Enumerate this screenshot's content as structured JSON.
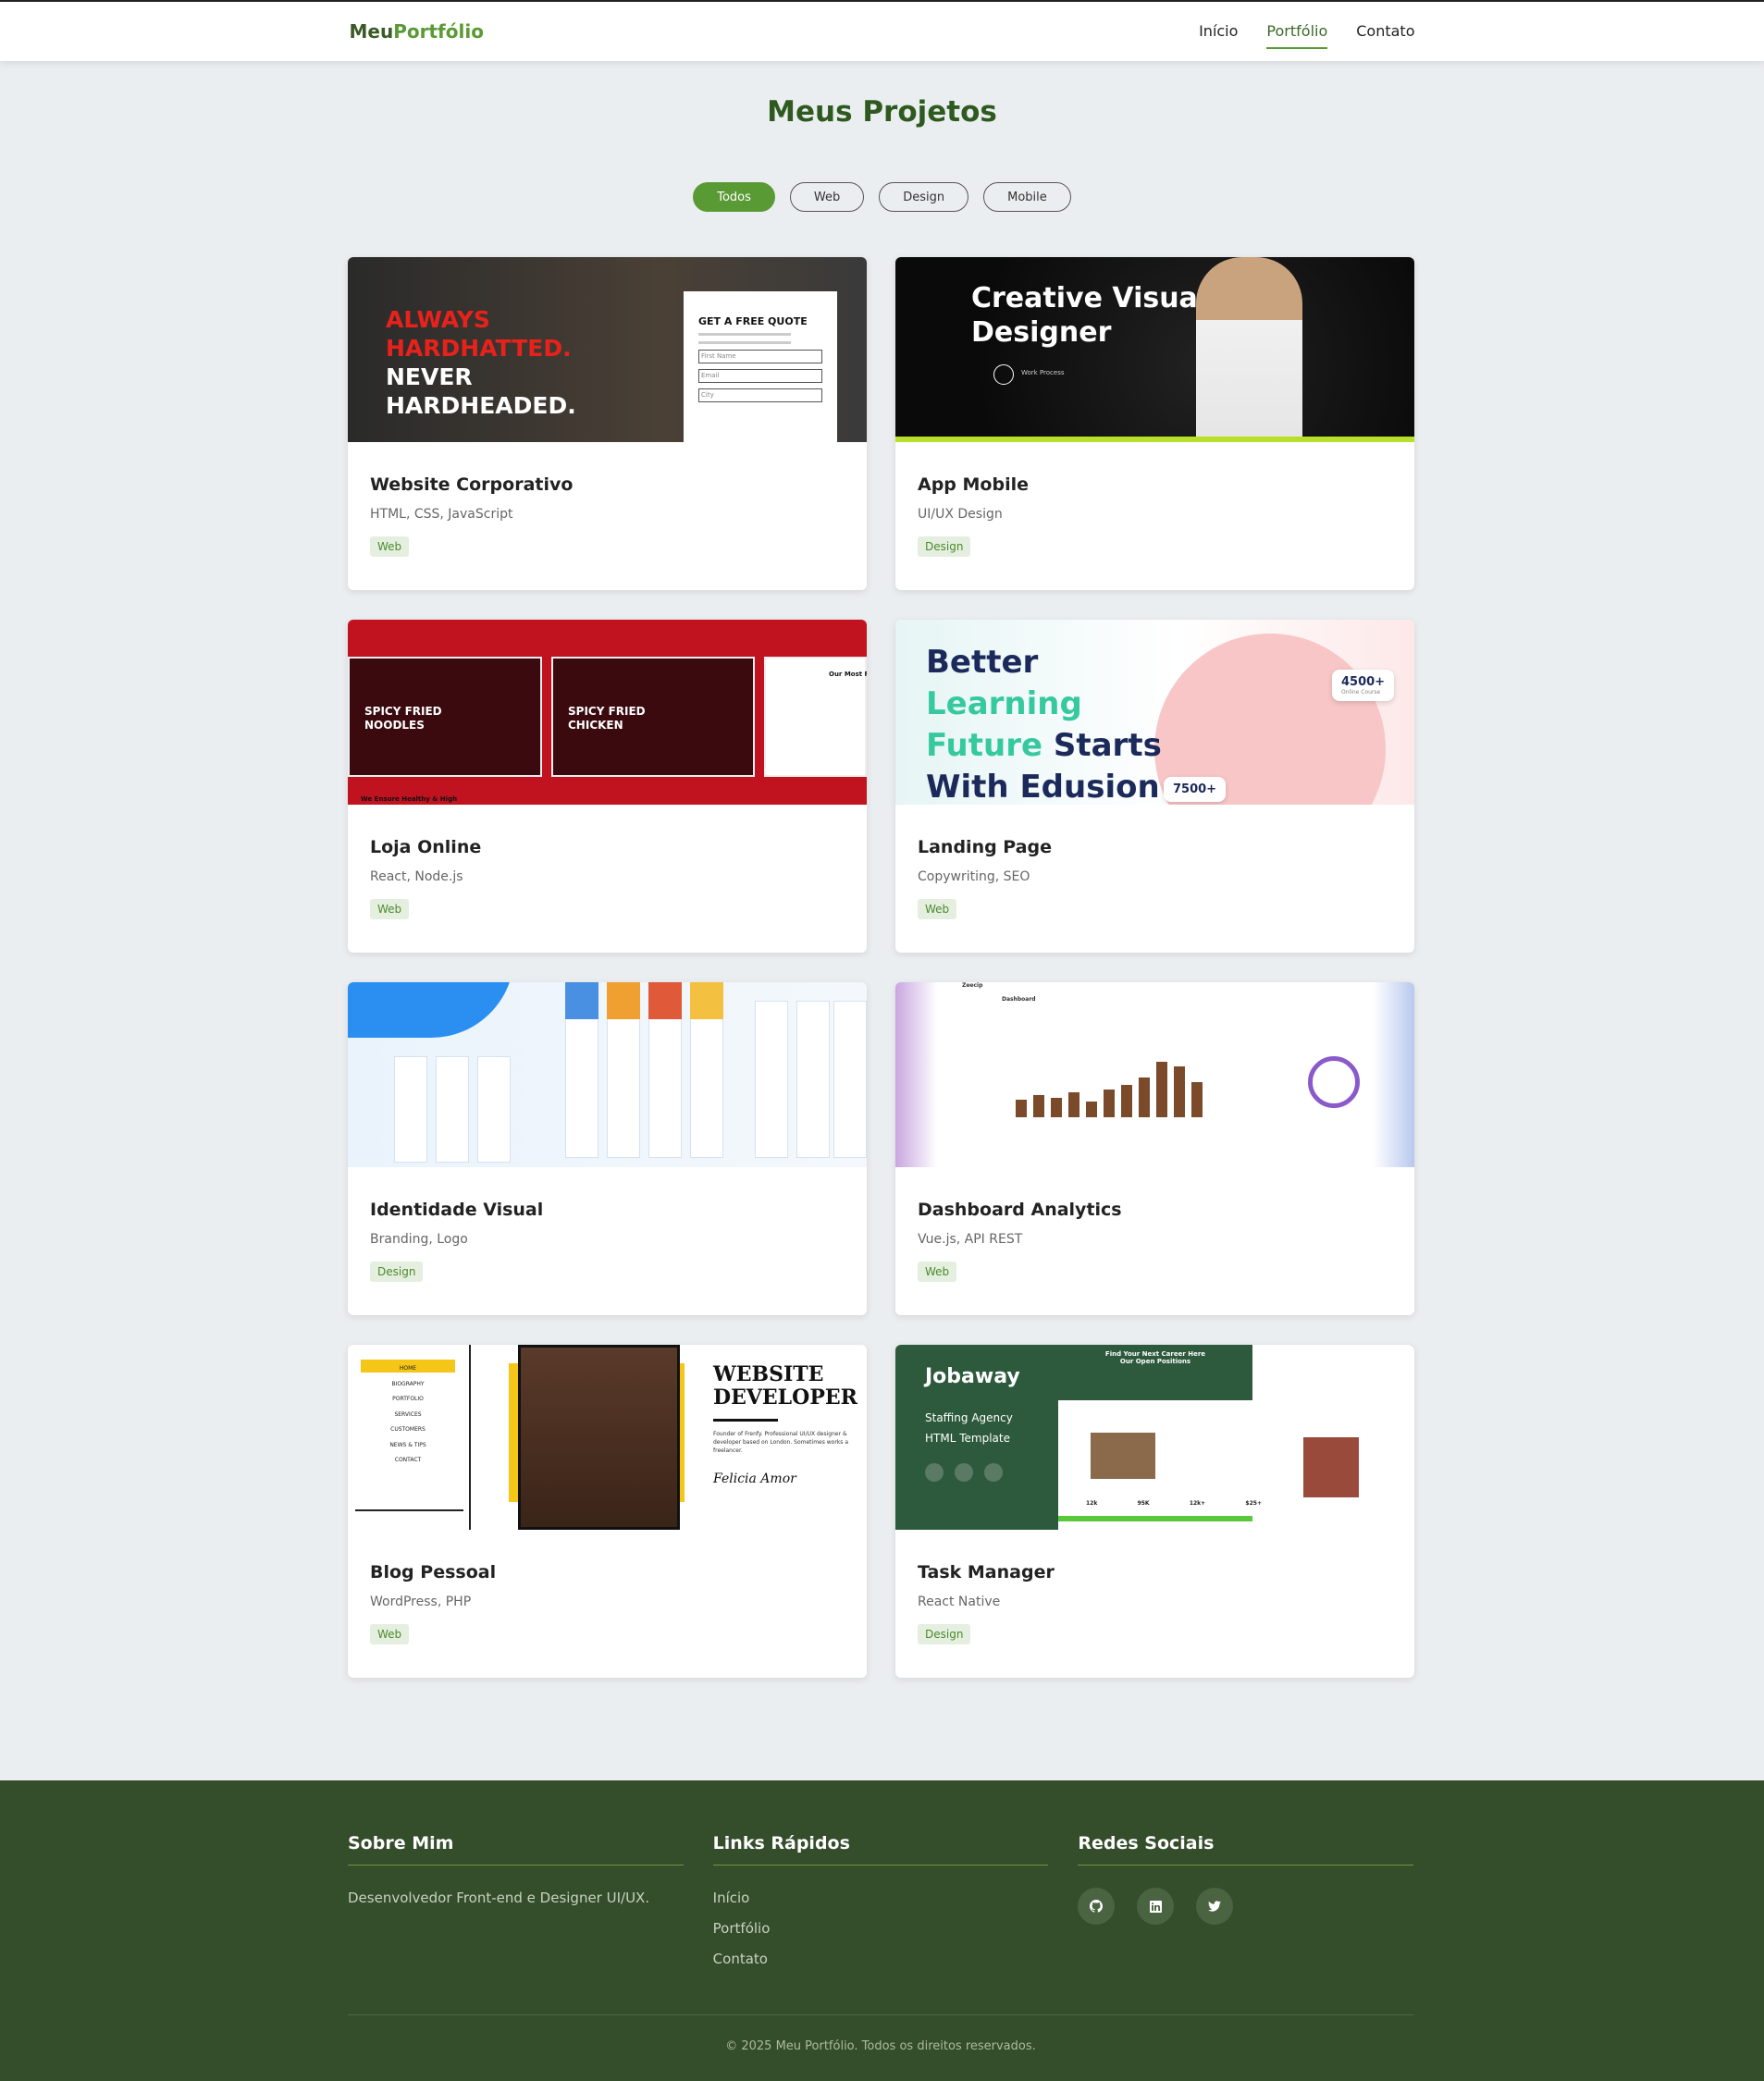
{
  "header": {
    "logo_main": "Meu",
    "logo_accent": "Portfólio",
    "nav": [
      "Início",
      "Portfólio",
      "Contato"
    ],
    "active_nav": "Portfólio"
  },
  "page": {
    "title": "Meus Projetos",
    "filters": [
      "Todos",
      "Web",
      "Design",
      "Mobile"
    ],
    "active_filter": "Todos"
  },
  "projects": [
    {
      "title": "Website Corporativo",
      "tech": "HTML, CSS, JavaScript",
      "tag": "Web",
      "thumb": {
        "l1": "ALWAYS",
        "l2": "HARDHATTED.",
        "l3": "NEVER",
        "l4": "HARDHEADED.",
        "form_title": "GET A FREE QUOTE",
        "f1": "First Name",
        "f2": "Email",
        "f3": "City"
      }
    },
    {
      "title": "App Mobile",
      "tech": "UI/UX Design",
      "tag": "Design",
      "thumb": {
        "headline": "Creative Visual Designer",
        "sub": "Work Process"
      }
    },
    {
      "title": "Loja Online",
      "tech": "React, Node.js",
      "tag": "Web",
      "thumb": {
        "t1": "SPICY FRIED NOODLES",
        "t2": "SPICY FRIED CHICKEN",
        "t3": "Our Most Po",
        "t4": "We Ensure Healthy & High"
      }
    },
    {
      "title": "Landing Page",
      "tech": "Copywriting, SEO",
      "tag": "Web",
      "thumb": {
        "w1": "Better",
        "w2": "Learning",
        "w3": "Future",
        "w4": "Starts",
        "w5": "With Edusion",
        "s1": "4500+",
        "s1_label": "Online Course",
        "s2": "7500+"
      }
    },
    {
      "title": "Identidade Visual",
      "tech": "Branding, Logo",
      "tag": "Design",
      "thumb": {}
    },
    {
      "title": "Dashboard Analytics",
      "tech": "Vue.js, API REST",
      "tag": "Web",
      "thumb": {
        "brand": "Zeecip",
        "heading": "Dashboard",
        "bars": [
          12,
          15,
          13,
          17,
          11,
          19,
          22,
          27,
          38,
          35,
          24
        ]
      }
    },
    {
      "title": "Blog Pessoal",
      "tech": "WordPress, PHP",
      "tag": "Web",
      "thumb": {
        "menu": [
          "HOME",
          "BIOGRAPHY",
          "PORTFOLIO",
          "SERVICES",
          "CUSTOMERS",
          "NEWS & TIPS",
          "CONTACT"
        ],
        "h1": "WEBSITE",
        "h2": "DEVELOPER",
        "bio": "Founder of Frenfy. Professional UI/UX designer & developer based on London. Sometimes works a freelancer.",
        "signature": "Felicia Amor"
      }
    },
    {
      "title": "Task Manager",
      "tech": "React Native",
      "tag": "Design",
      "thumb": {
        "name": "Jobaway",
        "s1": "Staffing Agency",
        "s2": "HTML Template",
        "hero": "Find Your Next Career Here Our Open Positions",
        "stats": [
          "12k",
          "95K",
          "12k+",
          "$25+"
        ]
      }
    }
  ],
  "footer": {
    "about_title": "Sobre Mim",
    "about_text": "Desenvolvedor Front-end e Designer UI/UX.",
    "links_title": "Links Rápidos",
    "links": [
      "Início",
      "Portfólio",
      "Contato"
    ],
    "social_title": "Redes Sociais",
    "social_icons": [
      "github-icon",
      "linkedin-icon",
      "twitter-icon"
    ],
    "copyright": "© 2025 Meu Portfólio. Todos os direitos reservados."
  },
  "colors": {
    "brand": "#5a9a35",
    "brand_dark": "#2f5a1f",
    "footer_bg": "#344d2b",
    "page_bg": "#ebeef0"
  }
}
